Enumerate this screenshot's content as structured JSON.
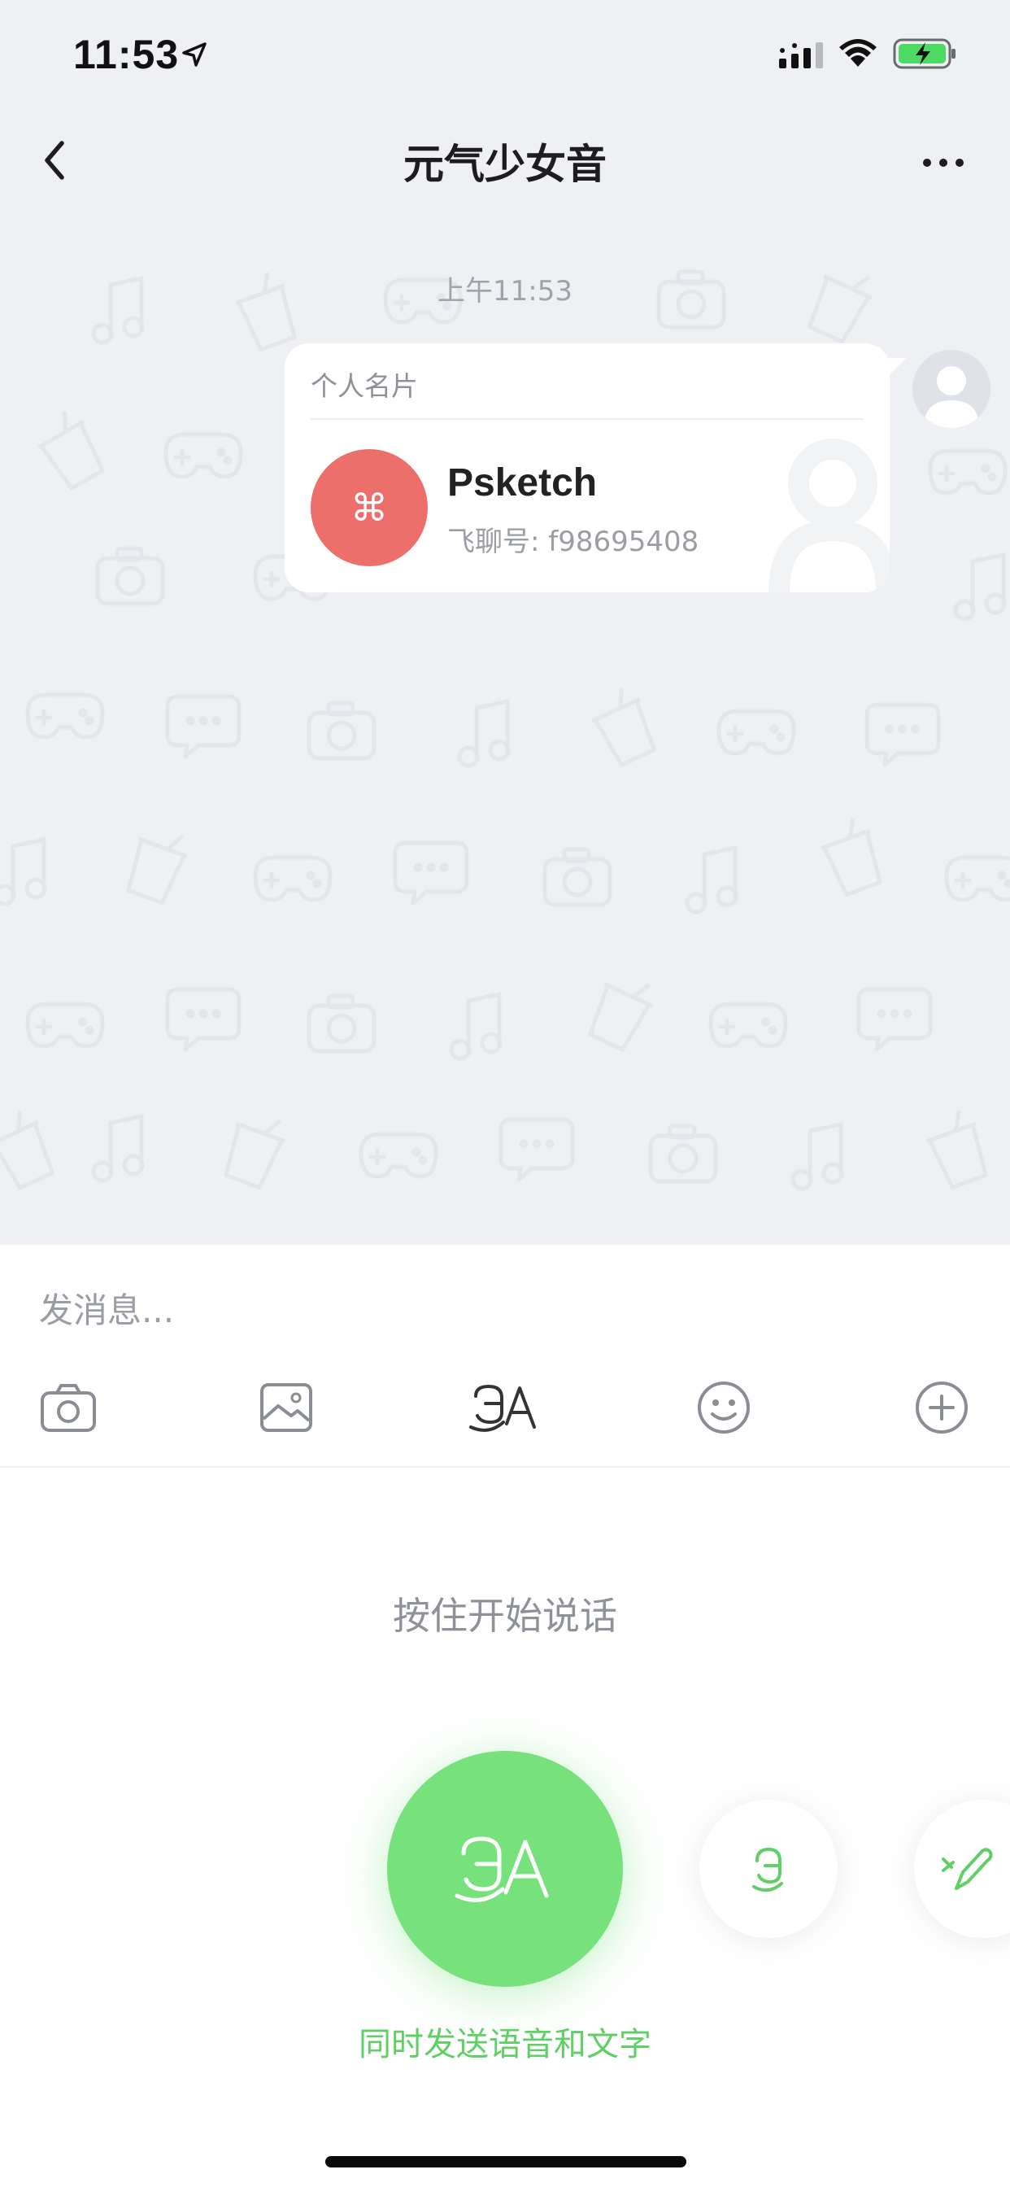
{
  "status_bar": {
    "time": "11:53",
    "icons": [
      "location-arrow-icon",
      "signal-icon",
      "wifi-icon",
      "battery-charging-icon"
    ]
  },
  "nav": {
    "title": "元气少女音",
    "back_icon": "chevron-left-icon",
    "more_icon": "more-horizontal-icon"
  },
  "chat": {
    "timestamp": "上午11:53",
    "contact_card": {
      "type_label": "个人名片",
      "name": "Psketch",
      "id_text": "飞聊号: f98695408",
      "avatar_glyph": "⌘",
      "avatar_color": "#ec6f6c"
    }
  },
  "input": {
    "placeholder": "发消息...",
    "toolbar_icons": [
      "camera-icon",
      "image-icon",
      "voice-text-icon",
      "emoji-icon",
      "plus-circle-icon"
    ]
  },
  "voice_panel": {
    "hint": "按住开始说话",
    "mode_label": "同时发送语音和文字",
    "accent_color": "#77e27c",
    "modes": [
      "voice-and-text",
      "voice-only",
      "voice-to-text"
    ]
  }
}
